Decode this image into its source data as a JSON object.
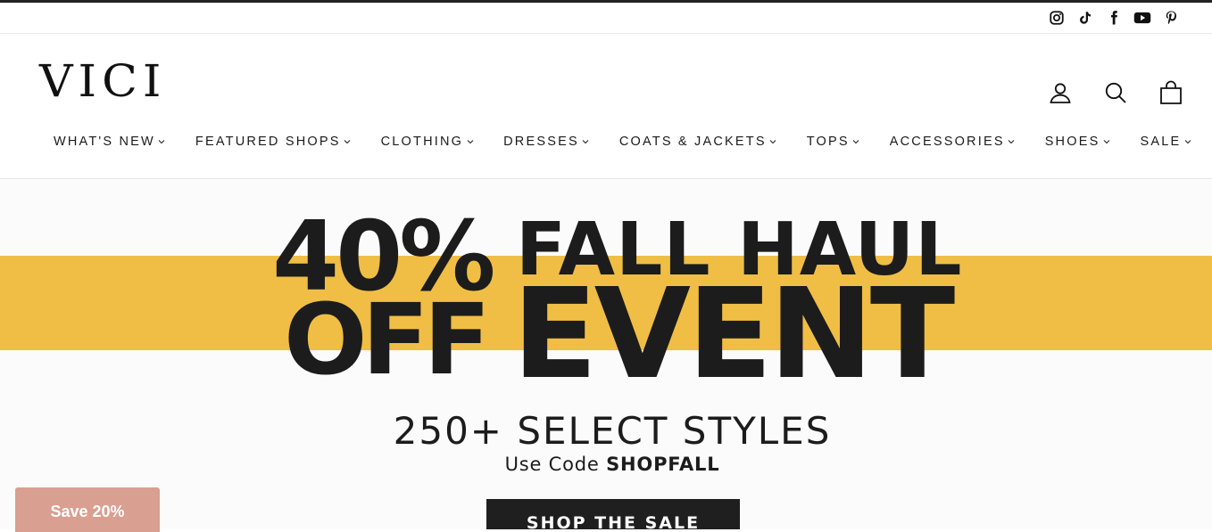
{
  "header": {
    "logo": "VICI",
    "social_icons": [
      "instagram-icon",
      "tiktok-icon",
      "facebook-icon",
      "youtube-icon",
      "pinterest-icon"
    ],
    "icons": [
      "account-icon",
      "search-icon",
      "bag-icon"
    ]
  },
  "nav": {
    "items": [
      {
        "label": "WHAT'S NEW"
      },
      {
        "label": "FEATURED SHOPS"
      },
      {
        "label": "CLOTHING"
      },
      {
        "label": "DRESSES"
      },
      {
        "label": "COATS & JACKETS"
      },
      {
        "label": "TOPS"
      },
      {
        "label": "ACCESSORIES"
      },
      {
        "label": "SHOES"
      },
      {
        "label": "SALE"
      }
    ]
  },
  "hero": {
    "percent": "40%",
    "off": "OFF",
    "fall_haul": "FALL HAUL",
    "event": "EVENT",
    "styles": "250+ SELECT STYLES",
    "code_prefix": "Use Code ",
    "code": "SHOPFALL",
    "button": "SHOP THE SALE",
    "band_color": "#f0be45"
  },
  "promo": {
    "save_label": "Save 20%",
    "color": "#d99f91"
  }
}
